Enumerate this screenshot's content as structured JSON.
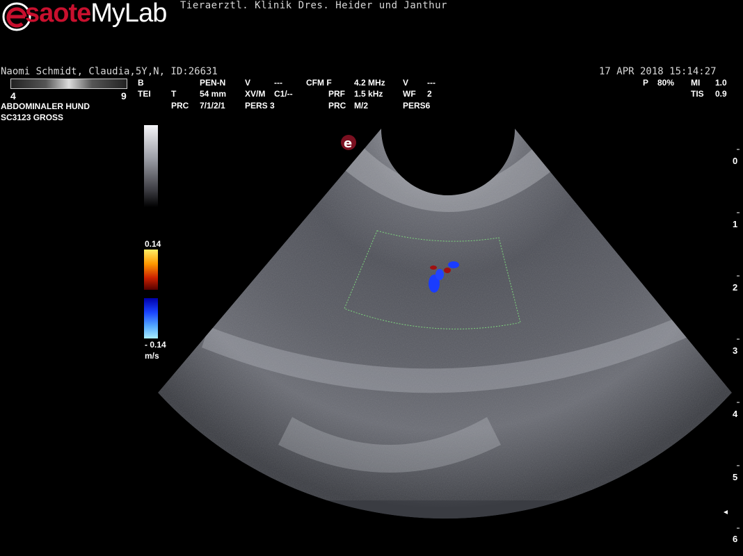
{
  "header": {
    "brand_e": "e",
    "brand_saote": "saote",
    "brand_mylab": "MyLab",
    "clinic": "Tieraerztl. Klinik Dres. Heider und Janthur"
  },
  "patient": {
    "info": "Naomi Schmidt, Claudia,5Y,N, ID:26631",
    "datetime": "17  APR  2018 15:14:27"
  },
  "grayscale": {
    "min": "4",
    "max": "9"
  },
  "exam": {
    "preset": "ABDOMINALER HUND",
    "probe": "SC3123  GROSS"
  },
  "params": {
    "b": "B",
    "tei": "TEI",
    "pen": "PEN-N",
    "t": "T",
    "depth": "54 mm",
    "prc_lbl": "PRC",
    "prc_val": "7/1/2/1",
    "v1": "V",
    "v1_val": "---",
    "xvm": "XV/M",
    "c1": "C1/--",
    "pers_lbl": "PERS 3",
    "cfm": "CFM F",
    "freq": "4.2 MHz",
    "prf": "PRF",
    "prf_val": "1.5 kHz",
    "prc2": "PRC",
    "prc2_val": "M/2",
    "v2": "V",
    "v2_val": "---",
    "wf": "WF",
    "wf_val": "2",
    "pers6": "PERS6",
    "p": "P",
    "p_val": "80%",
    "mi": "MI",
    "mi_val": "1.0",
    "tis": "TIS",
    "tis_val": "0.9"
  },
  "velocity": {
    "top": "0.14",
    "bottom": "- 0.14",
    "unit": "m/s"
  },
  "depth_scale": [
    "0",
    "1",
    "2",
    "3",
    "4",
    "5",
    "6"
  ],
  "colors": {
    "roi_outline": "#7ed67e",
    "flow_red": "#a01010",
    "flow_blue": "#1a3cff",
    "brand_red": "#c8102e"
  }
}
